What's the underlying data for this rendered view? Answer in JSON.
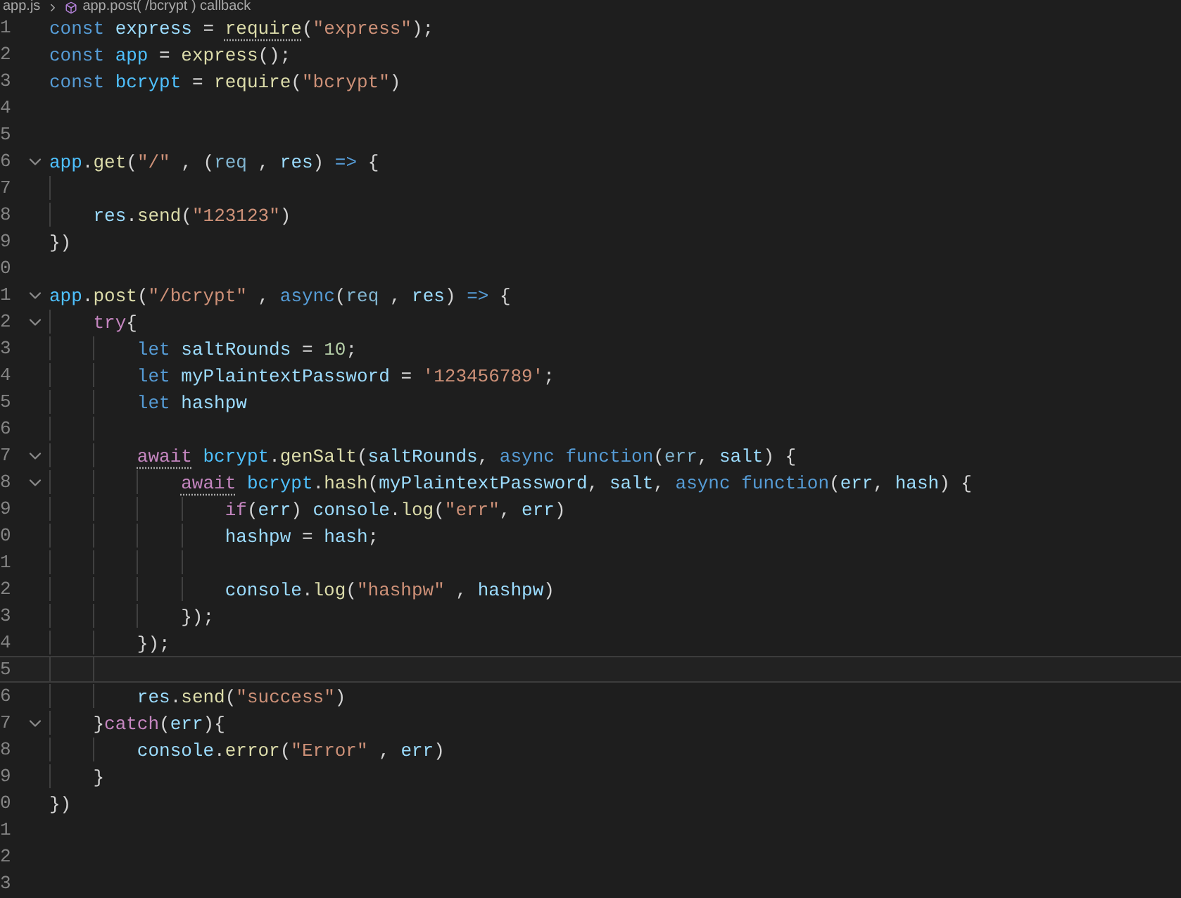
{
  "breadcrumb": {
    "file": "app.js",
    "symbol": "app.post( /bcrypt ) callback"
  },
  "lines": [
    {
      "number": "1",
      "foldable": false,
      "current": false,
      "tokens": [
        {
          "text": "const ",
          "kind": "keyword"
        },
        {
          "text": "express",
          "kind": "variable"
        },
        {
          "text": " = ",
          "kind": "punct"
        },
        {
          "text": "require",
          "kind": "function",
          "hint": true
        },
        {
          "text": "(",
          "kind": "punct"
        },
        {
          "text": "\"express\"",
          "kind": "string"
        },
        {
          "text": ");",
          "kind": "punct"
        }
      ]
    },
    {
      "number": "2",
      "foldable": false,
      "current": false,
      "tokens": [
        {
          "text": "const ",
          "kind": "keyword"
        },
        {
          "text": "app",
          "kind": "constant"
        },
        {
          "text": " = ",
          "kind": "punct"
        },
        {
          "text": "express",
          "kind": "function"
        },
        {
          "text": "();",
          "kind": "punct"
        }
      ]
    },
    {
      "number": "3",
      "foldable": false,
      "current": false,
      "tokens": [
        {
          "text": "const ",
          "kind": "keyword"
        },
        {
          "text": "bcrypt",
          "kind": "constant"
        },
        {
          "text": " = ",
          "kind": "punct"
        },
        {
          "text": "require",
          "kind": "function"
        },
        {
          "text": "(",
          "kind": "punct"
        },
        {
          "text": "\"bcrypt\"",
          "kind": "string"
        },
        {
          "text": ")",
          "kind": "punct"
        }
      ]
    },
    {
      "number": "4",
      "foldable": false,
      "current": false
    },
    {
      "number": "5",
      "foldable": false,
      "current": false
    },
    {
      "number": "6",
      "foldable": true,
      "current": false,
      "tokens": [
        {
          "text": "app",
          "kind": "constant"
        },
        {
          "text": ".",
          "kind": "punct"
        },
        {
          "text": "get",
          "kind": "function"
        },
        {
          "text": "(",
          "kind": "punct"
        },
        {
          "text": "\"/\"",
          "kind": "string"
        },
        {
          "text": " , (",
          "kind": "punct"
        },
        {
          "text": "req",
          "kind": "param"
        },
        {
          "text": " , ",
          "kind": "punct"
        },
        {
          "text": "res",
          "kind": "variable"
        },
        {
          "text": ") ",
          "kind": "punct"
        },
        {
          "text": "=>",
          "kind": "keyword"
        },
        {
          "text": " {",
          "kind": "punct"
        }
      ]
    },
    {
      "number": "7",
      "foldable": false,
      "current": false
    },
    {
      "number": "8",
      "foldable": false,
      "current": false,
      "tokens": [
        {
          "text": "    res",
          "kind": "variable"
        },
        {
          "text": ".",
          "kind": "punct"
        },
        {
          "text": "send",
          "kind": "function"
        },
        {
          "text": "(",
          "kind": "punct"
        },
        {
          "text": "\"123123\"",
          "kind": "string"
        },
        {
          "text": ")",
          "kind": "punct"
        }
      ]
    },
    {
      "number": "9",
      "foldable": false,
      "current": false,
      "tokens": [
        {
          "text": "})",
          "kind": "punct"
        }
      ]
    },
    {
      "number": "0",
      "foldable": false,
      "current": false
    },
    {
      "number": "1",
      "foldable": true,
      "current": false,
      "tokens": [
        {
          "text": "app",
          "kind": "constant"
        },
        {
          "text": ".",
          "kind": "punct"
        },
        {
          "text": "post",
          "kind": "function"
        },
        {
          "text": "(",
          "kind": "punct"
        },
        {
          "text": "\"/bcrypt\"",
          "kind": "string"
        },
        {
          "text": " , ",
          "kind": "punct"
        },
        {
          "text": "async",
          "kind": "keyword"
        },
        {
          "text": "(",
          "kind": "punct"
        },
        {
          "text": "req",
          "kind": "param"
        },
        {
          "text": " , ",
          "kind": "punct"
        },
        {
          "text": "res",
          "kind": "variable"
        },
        {
          "text": ") ",
          "kind": "punct"
        },
        {
          "text": "=>",
          "kind": "keyword"
        },
        {
          "text": " {",
          "kind": "punct"
        }
      ]
    },
    {
      "number": "2",
      "foldable": true,
      "current": false,
      "tokens": [
        {
          "text": "    try",
          "kind": "control"
        },
        {
          "text": "{",
          "kind": "punct"
        }
      ]
    },
    {
      "number": "3",
      "foldable": false,
      "current": false,
      "tokens": [
        {
          "text": "        let ",
          "kind": "keyword"
        },
        {
          "text": "saltRounds",
          "kind": "variable"
        },
        {
          "text": " = ",
          "kind": "punct"
        },
        {
          "text": "10",
          "kind": "number"
        },
        {
          "text": ";",
          "kind": "punct"
        }
      ]
    },
    {
      "number": "4",
      "foldable": false,
      "current": false,
      "tokens": [
        {
          "text": "        let ",
          "kind": "keyword"
        },
        {
          "text": "myPlaintextPassword",
          "kind": "variable"
        },
        {
          "text": " = ",
          "kind": "punct"
        },
        {
          "text": "'123456789'",
          "kind": "string"
        },
        {
          "text": ";",
          "kind": "punct"
        }
      ]
    },
    {
      "number": "5",
      "foldable": false,
      "current": false,
      "tokens": [
        {
          "text": "        let ",
          "kind": "keyword"
        },
        {
          "text": "hashpw",
          "kind": "variable"
        }
      ]
    },
    {
      "number": "6",
      "foldable": false,
      "current": false
    },
    {
      "number": "7",
      "foldable": true,
      "current": false,
      "tokens": [
        {
          "text": "        await",
          "kind": "control",
          "hint": true
        },
        {
          "text": " bcrypt",
          "kind": "constant"
        },
        {
          "text": ".",
          "kind": "punct"
        },
        {
          "text": "genSalt",
          "kind": "function"
        },
        {
          "text": "(",
          "kind": "punct"
        },
        {
          "text": "saltRounds",
          "kind": "variable"
        },
        {
          "text": ", ",
          "kind": "punct"
        },
        {
          "text": "async ",
          "kind": "keyword"
        },
        {
          "text": "function",
          "kind": "keyword"
        },
        {
          "text": "(",
          "kind": "punct"
        },
        {
          "text": "err",
          "kind": "param"
        },
        {
          "text": ", ",
          "kind": "punct"
        },
        {
          "text": "salt",
          "kind": "variable"
        },
        {
          "text": ") {",
          "kind": "punct"
        }
      ]
    },
    {
      "number": "8",
      "foldable": true,
      "current": false,
      "tokens": [
        {
          "text": "            await",
          "kind": "control",
          "hint": true
        },
        {
          "text": " bcrypt",
          "kind": "constant"
        },
        {
          "text": ".",
          "kind": "punct"
        },
        {
          "text": "hash",
          "kind": "function"
        },
        {
          "text": "(",
          "kind": "punct"
        },
        {
          "text": "myPlaintextPassword",
          "kind": "variable"
        },
        {
          "text": ", ",
          "kind": "punct"
        },
        {
          "text": "salt",
          "kind": "variable"
        },
        {
          "text": ", ",
          "kind": "punct"
        },
        {
          "text": "async ",
          "kind": "keyword"
        },
        {
          "text": "function",
          "kind": "keyword"
        },
        {
          "text": "(",
          "kind": "punct"
        },
        {
          "text": "err",
          "kind": "variable"
        },
        {
          "text": ", ",
          "kind": "punct"
        },
        {
          "text": "hash",
          "kind": "variable"
        },
        {
          "text": ") {",
          "kind": "punct"
        }
      ]
    },
    {
      "number": "9",
      "foldable": false,
      "current": false,
      "tokens": [
        {
          "text": "                if",
          "kind": "control"
        },
        {
          "text": "(",
          "kind": "punct"
        },
        {
          "text": "err",
          "kind": "variable"
        },
        {
          "text": ") ",
          "kind": "punct"
        },
        {
          "text": "console",
          "kind": "variable"
        },
        {
          "text": ".",
          "kind": "punct"
        },
        {
          "text": "log",
          "kind": "function"
        },
        {
          "text": "(",
          "kind": "punct"
        },
        {
          "text": "\"err\"",
          "kind": "string"
        },
        {
          "text": ", ",
          "kind": "punct"
        },
        {
          "text": "err",
          "kind": "variable"
        },
        {
          "text": ")",
          "kind": "punct"
        }
      ]
    },
    {
      "number": "0",
      "foldable": false,
      "current": false,
      "tokens": [
        {
          "text": "                hashpw",
          "kind": "variable"
        },
        {
          "text": " = ",
          "kind": "punct"
        },
        {
          "text": "hash",
          "kind": "variable"
        },
        {
          "text": ";",
          "kind": "punct"
        }
      ]
    },
    {
      "number": "1",
      "foldable": false,
      "current": false
    },
    {
      "number": "2",
      "foldable": false,
      "current": false,
      "tokens": [
        {
          "text": "                console",
          "kind": "variable"
        },
        {
          "text": ".",
          "kind": "punct"
        },
        {
          "text": "log",
          "kind": "function"
        },
        {
          "text": "(",
          "kind": "punct"
        },
        {
          "text": "\"hashpw\"",
          "kind": "string"
        },
        {
          "text": " , ",
          "kind": "punct"
        },
        {
          "text": "hashpw",
          "kind": "variable"
        },
        {
          "text": ")",
          "kind": "punct"
        }
      ]
    },
    {
      "number": "3",
      "foldable": false,
      "current": false,
      "tokens": [
        {
          "text": "            });",
          "kind": "punct"
        }
      ]
    },
    {
      "number": "4",
      "foldable": false,
      "current": false,
      "tokens": [
        {
          "text": "        });",
          "kind": "punct"
        }
      ]
    },
    {
      "number": "5",
      "foldable": false,
      "current": true
    },
    {
      "number": "6",
      "foldable": false,
      "current": false,
      "tokens": [
        {
          "text": "        res",
          "kind": "variable"
        },
        {
          "text": ".",
          "kind": "punct"
        },
        {
          "text": "send",
          "kind": "function"
        },
        {
          "text": "(",
          "kind": "punct"
        },
        {
          "text": "\"success\"",
          "kind": "string"
        },
        {
          "text": ")",
          "kind": "punct"
        }
      ]
    },
    {
      "number": "7",
      "foldable": true,
      "current": false,
      "tokens": [
        {
          "text": "    }",
          "kind": "punct"
        },
        {
          "text": "catch",
          "kind": "control"
        },
        {
          "text": "(",
          "kind": "punct"
        },
        {
          "text": "err",
          "kind": "variable"
        },
        {
          "text": "){",
          "kind": "punct"
        }
      ]
    },
    {
      "number": "8",
      "foldable": false,
      "current": false,
      "tokens": [
        {
          "text": "        console",
          "kind": "variable"
        },
        {
          "text": ".",
          "kind": "punct"
        },
        {
          "text": "error",
          "kind": "function"
        },
        {
          "text": "(",
          "kind": "punct"
        },
        {
          "text": "\"Error\"",
          "kind": "string"
        },
        {
          "text": " , ",
          "kind": "punct"
        },
        {
          "text": "err",
          "kind": "variable"
        },
        {
          "text": ")",
          "kind": "punct"
        }
      ]
    },
    {
      "number": "9",
      "foldable": false,
      "current": false,
      "tokens": [
        {
          "text": "    }",
          "kind": "punct"
        }
      ]
    },
    {
      "number": "0",
      "foldable": false,
      "current": false,
      "tokens": [
        {
          "text": "})",
          "kind": "punct"
        }
      ]
    },
    {
      "number": "1",
      "foldable": false,
      "current": false
    },
    {
      "number": "2",
      "foldable": false,
      "current": false
    },
    {
      "number": "3",
      "foldable": false,
      "current": false
    }
  ]
}
